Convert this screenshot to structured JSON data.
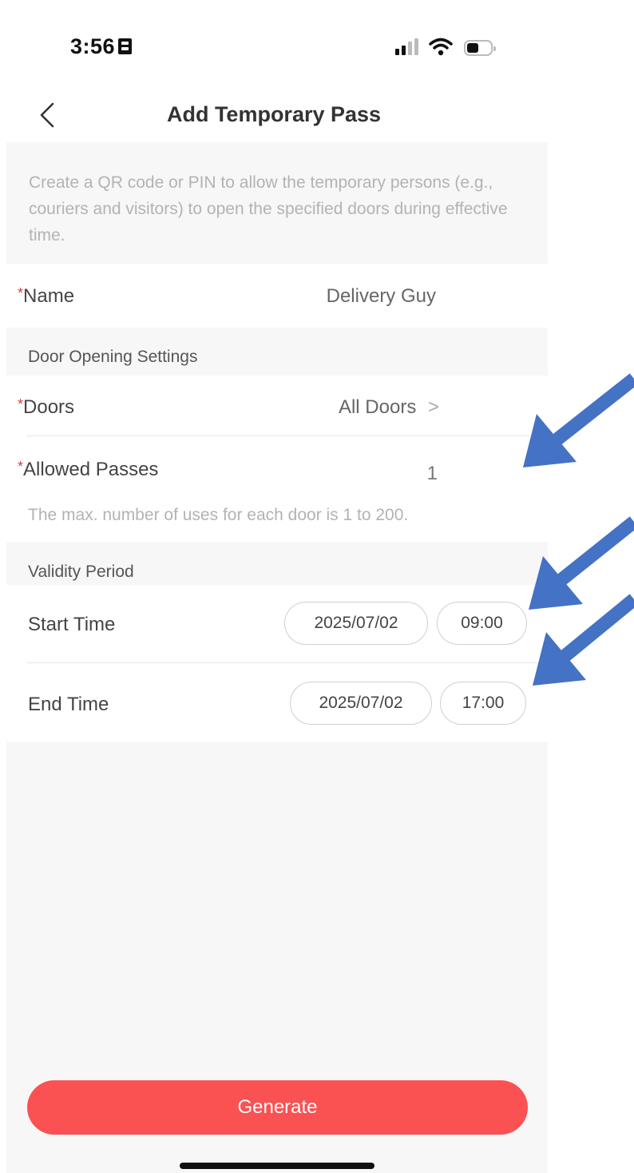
{
  "status_bar": {
    "time": "3:56"
  },
  "header": {
    "title": "Add Temporary Pass"
  },
  "intro": {
    "text": "Create a QR code or PIN to allow the temporary persons (e.g., couriers and visitors) to open the specified doors during effective time."
  },
  "name_row": {
    "required_mark": "*",
    "label": "Name",
    "value": "Delivery Guy"
  },
  "door_settings": {
    "section_title": "Door Opening Settings",
    "doors": {
      "required_mark": "*",
      "label": "Doors",
      "value": "All Doors",
      "chevron": ">"
    },
    "allowed_passes": {
      "required_mark": "*",
      "label": "Allowed Passes",
      "value": "1"
    },
    "helper": "The max. number of uses for each door is 1 to 200."
  },
  "validity": {
    "section_title": "Validity Period",
    "start": {
      "label": "Start Time",
      "date": "2025/07/02",
      "time": "09:00"
    },
    "end": {
      "label": "End Time",
      "date": "2025/07/02",
      "time": "17:00"
    }
  },
  "actions": {
    "generate_label": "Generate"
  },
  "colors": {
    "accent": "#fa5152",
    "required": "#e23b3b",
    "annotation_arrow": "#4472c4"
  }
}
